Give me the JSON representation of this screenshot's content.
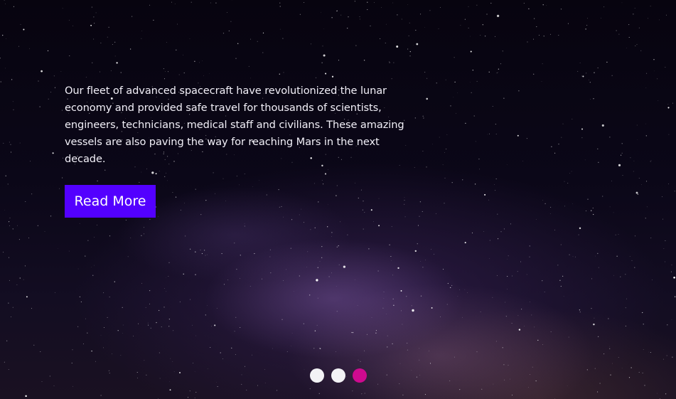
{
  "hero": {
    "paragraph": "Our fleet of advanced spacecraft have revolutionized the lunar economy and provided safe travel for thousands of scientists, engineers, technicians, medical staff and civilians. These amazing vessels are also paving the way for reaching Mars in the next decade.",
    "button_label": "Read More"
  },
  "carousel": {
    "total_slides": 3,
    "active_slide": 3
  },
  "colors": {
    "button": "#5300ff",
    "active_dot": "#ce0a8f",
    "inactive_dot": "#f2f2f5"
  }
}
